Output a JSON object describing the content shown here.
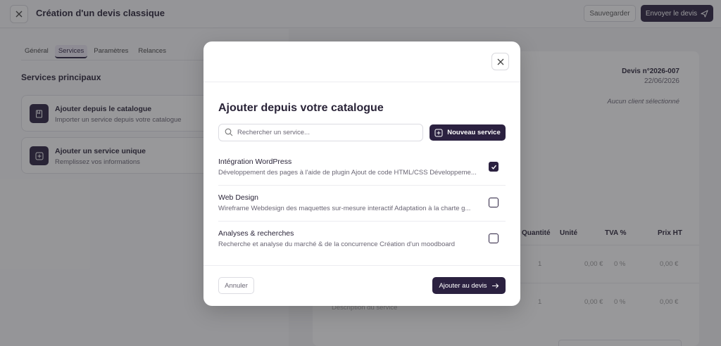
{
  "topbar": {
    "title": "Création d'un devis classique",
    "save_label": "Sauvegarder",
    "send_label": "Envoyer le devis"
  },
  "tabs": [
    "Général",
    "Services",
    "Paramètres",
    "Relances"
  ],
  "active_tab": "Services",
  "left": {
    "section_title": "Services principaux",
    "cards": [
      {
        "title": "Ajouter depuis le catalogue",
        "subtitle": "Importer un service depuis votre catalogue",
        "icon": "book-icon"
      },
      {
        "title": "Ajouter un service unique",
        "subtitle": "Remplissez vos informations",
        "icon": "plus-square-icon"
      }
    ]
  },
  "quote": {
    "number": "Devis n°2026-007",
    "date": "22/06/2026",
    "client": "Aucun client sélectionné",
    "columns": [
      "Quantité",
      "Unité",
      "TVA %",
      "Prix HT"
    ],
    "rows": [
      {
        "qty": "1",
        "tva_amount": "0,00 €",
        "tva_pct": "0 %",
        "price": "0,00 €"
      },
      {
        "qty": "1",
        "tva_amount": "0,00 €",
        "tva_pct": "0 %",
        "price": "0,00 €"
      }
    ],
    "description_placeholder": "Description du service"
  },
  "modal": {
    "title": "Ajouter depuis votre catalogue",
    "search_placeholder": "Rechercher un service...",
    "new_service_label": "Nouveau service",
    "services": [
      {
        "name": "Intégration WordPress",
        "description": "Développement des pages à l'aide de plugin Ajout de code HTML/CSS Développeme...",
        "checked": true
      },
      {
        "name": "Web Design",
        "description": "Wireframe Webdesign des maquettes sur-mesure interactif Adaptation à la charte g...",
        "checked": false
      },
      {
        "name": "Analyses & recherches",
        "description": "Recherche et analyse du marché & de la concurrence Création d'un moodboard",
        "checked": false
      }
    ],
    "cancel_label": "Annuler",
    "add_label": "Ajouter au devis"
  },
  "colors": {
    "accent": "#2b2140",
    "overlay": "rgba(40,40,44,0.48)"
  }
}
